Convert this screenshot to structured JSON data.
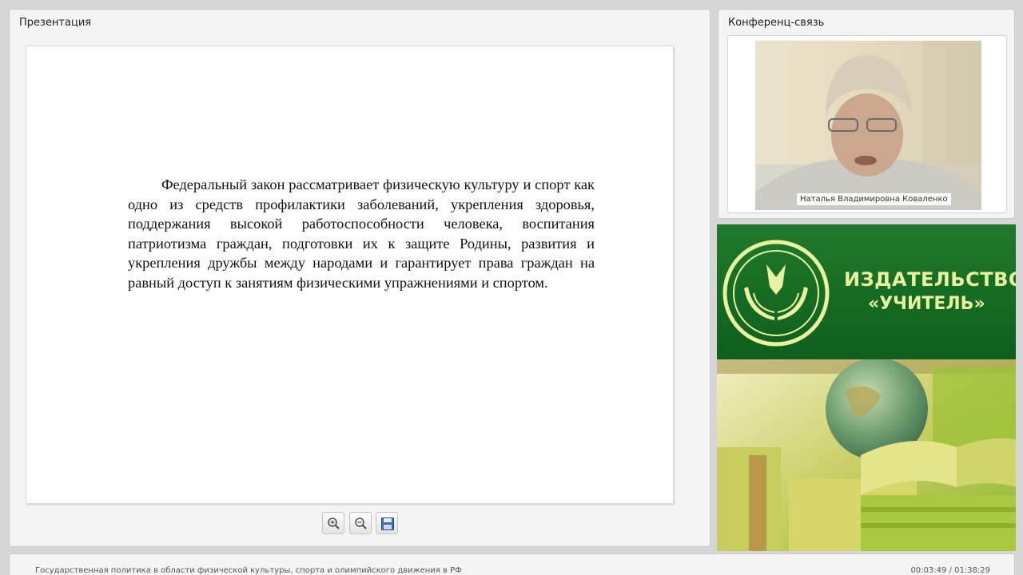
{
  "presentation": {
    "title": "Презентация",
    "slide_text": "Федеральный закон рассматривает физическую культуру и спорт как одно из средств профилактики заболеваний, укрепления здоровья, поддержания высокой работоспособности человека, воспитания патриотизма граждан, подготовки их к защите Родины, развития и укрепления дружбы между народами и гарантирует права граждан на равный доступ к занятиям физическими упражнениями и спортом.",
    "toolbar": {
      "zoom_in_icon": "zoom-in-icon",
      "zoom_out_icon": "zoom-out-icon",
      "save_icon": "floppy-disk-icon"
    }
  },
  "conference": {
    "title": "Конференц-связь",
    "speaker_name": "Наталья Владимировна Коваленко"
  },
  "banner": {
    "line1": "ИЗДАТЕЛЬСТВО",
    "line2": "«УЧИТЕЛЬ»",
    "colors": {
      "green": "#15692a",
      "text": "#e8f2a0"
    }
  },
  "status_bar": {
    "course_title": "Государственная политика в области физической культуры, спорта и олимпийского движения в РФ",
    "time": "00:03:49 / 01:38:29"
  }
}
